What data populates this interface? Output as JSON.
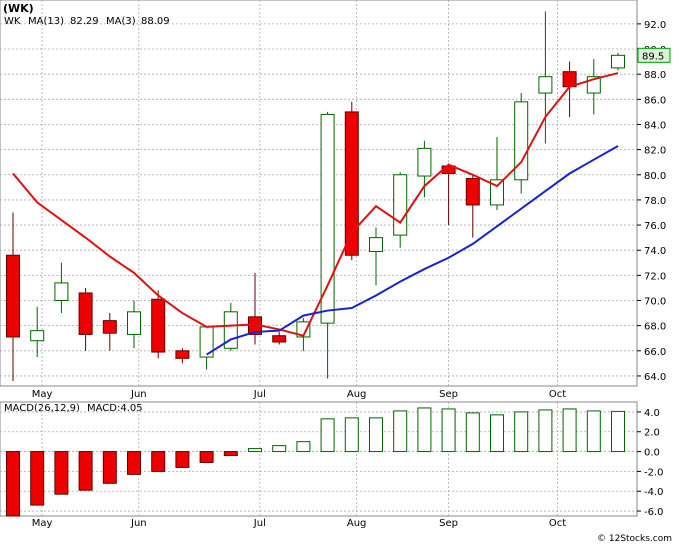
{
  "chart_data": [
    {
      "type": "candlestick",
      "ticker_label": "(WK)",
      "legend": [
        {
          "name": "WK",
          "color": "#000000"
        },
        {
          "name": "MA(13)",
          "value": "82.29",
          "color": "#0000cc"
        },
        {
          "name": "MA(3)",
          "value": "88.09",
          "color": "#cc0000"
        }
      ],
      "last_price_label": "89.5",
      "y_ticks": [
        "64.0",
        "66.0",
        "68.0",
        "70.0",
        "72.0",
        "74.0",
        "76.0",
        "78.0",
        "80.0",
        "82.0",
        "84.0",
        "86.0",
        "88.0",
        "90.0",
        "92.0"
      ],
      "ylim": [
        63.2,
        93.9
      ],
      "x_labels": [
        "May",
        "Jun",
        "Jul",
        "Aug",
        "Sep",
        "Oct"
      ],
      "x_label_weeks": [
        1.2,
        5.2,
        10.2,
        14.2,
        18.0,
        22.5
      ],
      "candles": [
        {
          "w": 0,
          "o": 73.6,
          "h": 77.0,
          "l": 63.6,
          "c": 67.1
        },
        {
          "w": 1,
          "o": 66.8,
          "h": 69.5,
          "l": 65.5,
          "c": 67.6
        },
        {
          "w": 2,
          "o": 70.0,
          "h": 73.0,
          "l": 69.0,
          "c": 71.4
        },
        {
          "w": 3,
          "o": 70.6,
          "h": 71.0,
          "l": 66.0,
          "c": 67.3
        },
        {
          "w": 4,
          "o": 68.4,
          "h": 69.0,
          "l": 66.0,
          "c": 67.4
        },
        {
          "w": 5,
          "o": 67.3,
          "h": 70.0,
          "l": 66.2,
          "c": 69.1
        },
        {
          "w": 6,
          "o": 70.1,
          "h": 70.8,
          "l": 65.4,
          "c": 65.9
        },
        {
          "w": 7,
          "o": 66.0,
          "h": 66.2,
          "l": 65.0,
          "c": 65.4
        },
        {
          "w": 8,
          "o": 65.5,
          "h": 68.0,
          "l": 64.5,
          "c": 67.9
        },
        {
          "w": 9,
          "o": 66.2,
          "h": 69.8,
          "l": 66.0,
          "c": 69.1
        },
        {
          "w": 10,
          "o": 68.7,
          "h": 72.2,
          "l": 66.5,
          "c": 67.3
        },
        {
          "w": 11,
          "o": 67.2,
          "h": 67.5,
          "l": 66.5,
          "c": 66.7
        },
        {
          "w": 12,
          "o": 67.1,
          "h": 68.6,
          "l": 66.0,
          "c": 68.3
        },
        {
          "w": 13,
          "o": 68.2,
          "h": 85.0,
          "l": 63.8,
          "c": 84.8
        },
        {
          "w": 14,
          "o": 85.0,
          "h": 85.8,
          "l": 73.2,
          "c": 73.6
        },
        {
          "w": 15,
          "o": 73.9,
          "h": 75.8,
          "l": 71.2,
          "c": 75.0
        },
        {
          "w": 16,
          "o": 75.2,
          "h": 80.2,
          "l": 74.2,
          "c": 80.0
        },
        {
          "w": 17,
          "o": 79.9,
          "h": 82.7,
          "l": 78.2,
          "c": 82.1
        },
        {
          "w": 18,
          "o": 80.7,
          "h": 80.9,
          "l": 76.0,
          "c": 80.1
        },
        {
          "w": 19,
          "o": 79.7,
          "h": 80.0,
          "l": 75.0,
          "c": 77.6
        },
        {
          "w": 20,
          "o": 77.6,
          "h": 83.0,
          "l": 77.2,
          "c": 79.6
        },
        {
          "w": 21,
          "o": 79.6,
          "h": 86.5,
          "l": 78.5,
          "c": 85.8
        },
        {
          "w": 22,
          "o": 86.5,
          "h": 93.0,
          "l": 82.5,
          "c": 87.8
        },
        {
          "w": 23,
          "o": 88.2,
          "h": 89.0,
          "l": 84.6,
          "c": 87.0
        },
        {
          "w": 24,
          "o": 86.5,
          "h": 89.2,
          "l": 84.8,
          "c": 87.8
        },
        {
          "w": 25,
          "o": 88.5,
          "h": 89.7,
          "l": 88.3,
          "c": 89.5
        }
      ],
      "ma3": [
        80.1,
        77.8,
        76.4,
        75.0,
        73.5,
        72.2,
        70.4,
        69.0,
        67.9,
        68.0,
        68.1,
        67.7,
        67.2,
        71.2,
        75.4,
        77.5,
        76.2,
        79.1,
        80.8,
        80.0,
        79.1,
        81.0,
        84.6,
        87.0,
        87.6,
        88.09
      ],
      "ma3_start": 0,
      "ma13": [
        65.7,
        66.9,
        67.5,
        67.6,
        68.8,
        69.2,
        69.4,
        70.4,
        71.5,
        72.5,
        73.4,
        74.5,
        75.9,
        77.3,
        78.7,
        80.1,
        81.2,
        82.29
      ],
      "ma13_start": 8,
      "colors": {
        "up_fill": "#ffffff",
        "up_stroke": "#006400",
        "down_fill": "#ee0000",
        "down_stroke": "#660000",
        "ma3": "#dd1111",
        "ma13": "#1a22cc",
        "grid": "#aaaaaa",
        "price_box": "#d9f2d9"
      }
    },
    {
      "type": "bar",
      "title": "MACD(26,12,9)",
      "value_label": "MACD:4.05",
      "y_ticks": [
        "-6.0",
        "-4.0",
        "-2.0",
        "0.0",
        "2.0",
        "4.0"
      ],
      "ylim": [
        -6.5,
        5.0
      ],
      "x_labels": [
        "May",
        "Jun",
        "Jul",
        "Aug",
        "Sep",
        "Oct"
      ],
      "values": [
        -6.5,
        -5.4,
        -4.3,
        -3.9,
        -3.2,
        -2.3,
        -2.0,
        -1.6,
        -1.1,
        -0.4,
        0.3,
        0.6,
        1.0,
        3.3,
        3.4,
        3.4,
        4.1,
        4.4,
        4.3,
        3.9,
        3.7,
        4.0,
        4.2,
        4.3,
        4.1,
        4.05
      ],
      "colors": {
        "pos_fill": "#ffffff",
        "pos_stroke": "#006400",
        "neg_fill": "#ee0000",
        "neg_stroke": "#660000"
      }
    }
  ],
  "footer": {
    "copyright": "© 12Stocks.com"
  }
}
